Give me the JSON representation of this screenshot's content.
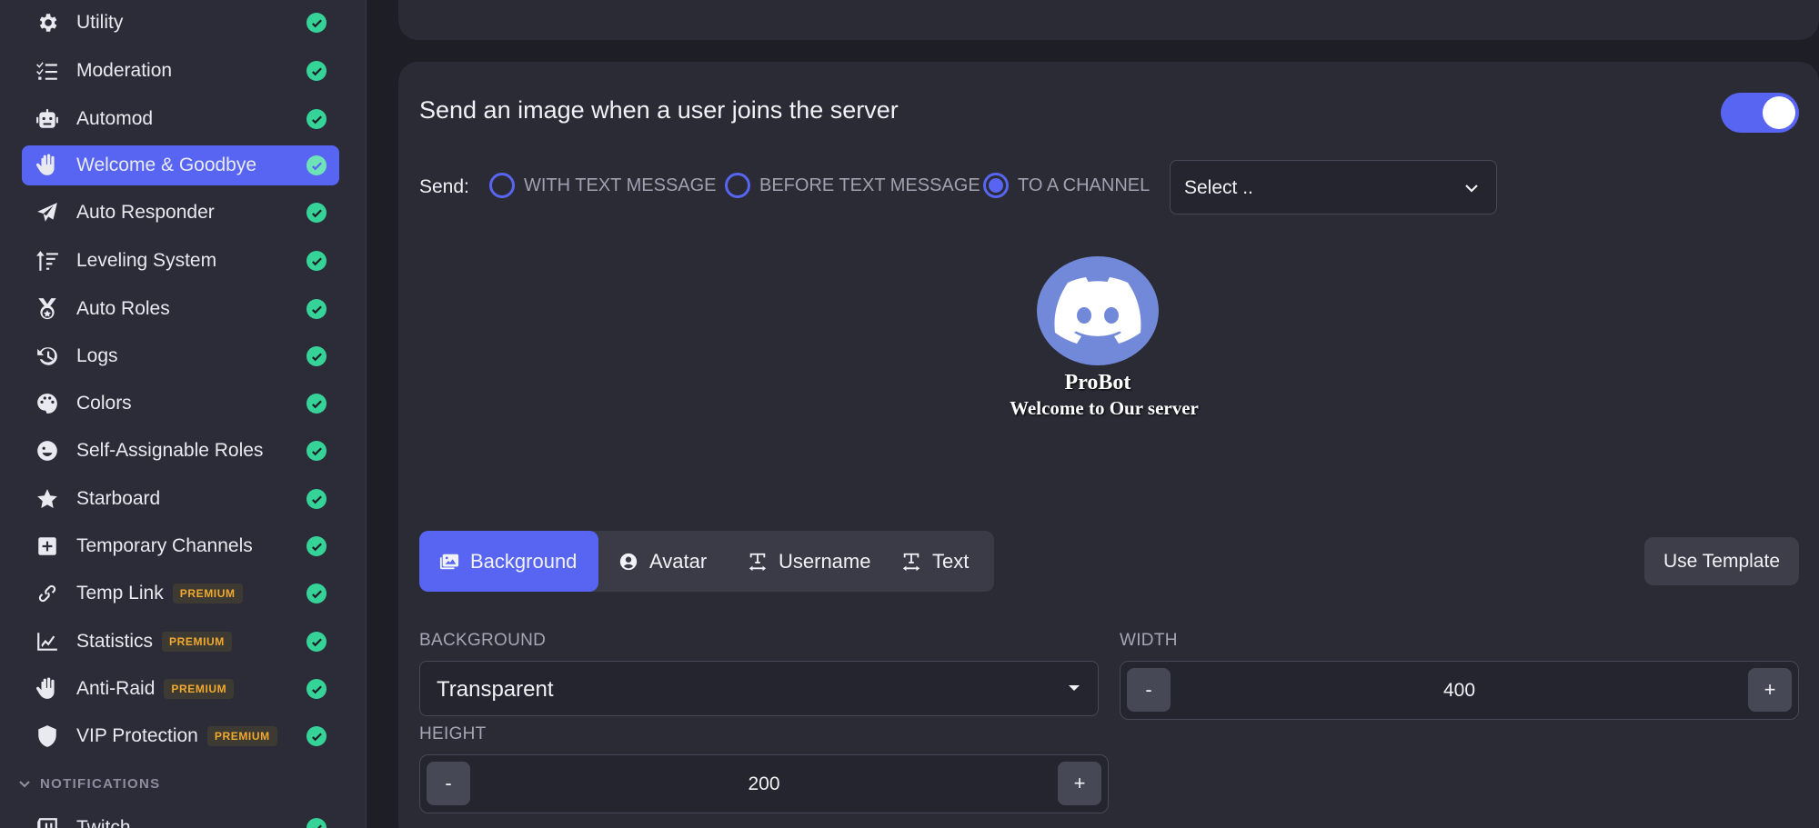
{
  "sidebar": {
    "items": [
      {
        "label": "Utility",
        "icon": "gear-icon",
        "premium": false
      },
      {
        "label": "Moderation",
        "icon": "list-check-icon",
        "premium": false
      },
      {
        "label": "Automod",
        "icon": "robot-icon",
        "premium": false
      },
      {
        "label": "Welcome & Goodbye",
        "icon": "hand-wave-icon",
        "premium": false,
        "active": true
      },
      {
        "label": "Auto Responder",
        "icon": "paper-plane-icon",
        "premium": false
      },
      {
        "label": "Leveling System",
        "icon": "sort-up-icon",
        "premium": false
      },
      {
        "label": "Auto Roles",
        "icon": "medal-icon",
        "premium": false
      },
      {
        "label": "Logs",
        "icon": "history-icon",
        "premium": false
      },
      {
        "label": "Colors",
        "icon": "palette-icon",
        "premium": false
      },
      {
        "label": "Self-Assignable Roles",
        "icon": "smile-wink-icon",
        "premium": false
      },
      {
        "label": "Starboard",
        "icon": "star-icon",
        "premium": false
      },
      {
        "label": "Temporary Channels",
        "icon": "plus-square-icon",
        "premium": false
      },
      {
        "label": "Temp Link",
        "icon": "link-icon",
        "premium": true
      },
      {
        "label": "Statistics",
        "icon": "chart-line-icon",
        "premium": true
      },
      {
        "label": "Anti-Raid",
        "icon": "hand-icon",
        "premium": true
      },
      {
        "label": "VIP Protection",
        "icon": "shield-icon",
        "premium": true
      },
      {
        "label": "Twitch",
        "icon": "twitch-icon",
        "premium": false
      }
    ],
    "premium_badge": "PREMIUM",
    "notifications_header": "NOTIFICATIONS"
  },
  "welcome_image": {
    "title": "Send an image when a user joins the server",
    "enabled": true,
    "send_label": "Send:",
    "send_options": [
      "WITH TEXT MESSAGE",
      "BEFORE TEXT MESSAGE",
      "TO A CHANNEL"
    ],
    "selected_option": "TO A CHANNEL",
    "channel_select_placeholder": "Select ..",
    "preview": {
      "username": "ProBot",
      "text": "Welcome to Our server"
    },
    "tabs": [
      "Background",
      "Avatar",
      "Username",
      "Text"
    ],
    "active_tab": "Background",
    "use_template_label": "Use Template",
    "background_label": "BACKGROUND",
    "background_value": "Transparent",
    "width_label": "WIDTH",
    "width_value": "400",
    "height_label": "HEIGHT",
    "height_value": "200",
    "minus": "-",
    "plus": "+"
  },
  "colors": {
    "accent": "#5865f2",
    "check": "#36d399",
    "premium": "#f2a92e",
    "discord": "#7289da"
  }
}
